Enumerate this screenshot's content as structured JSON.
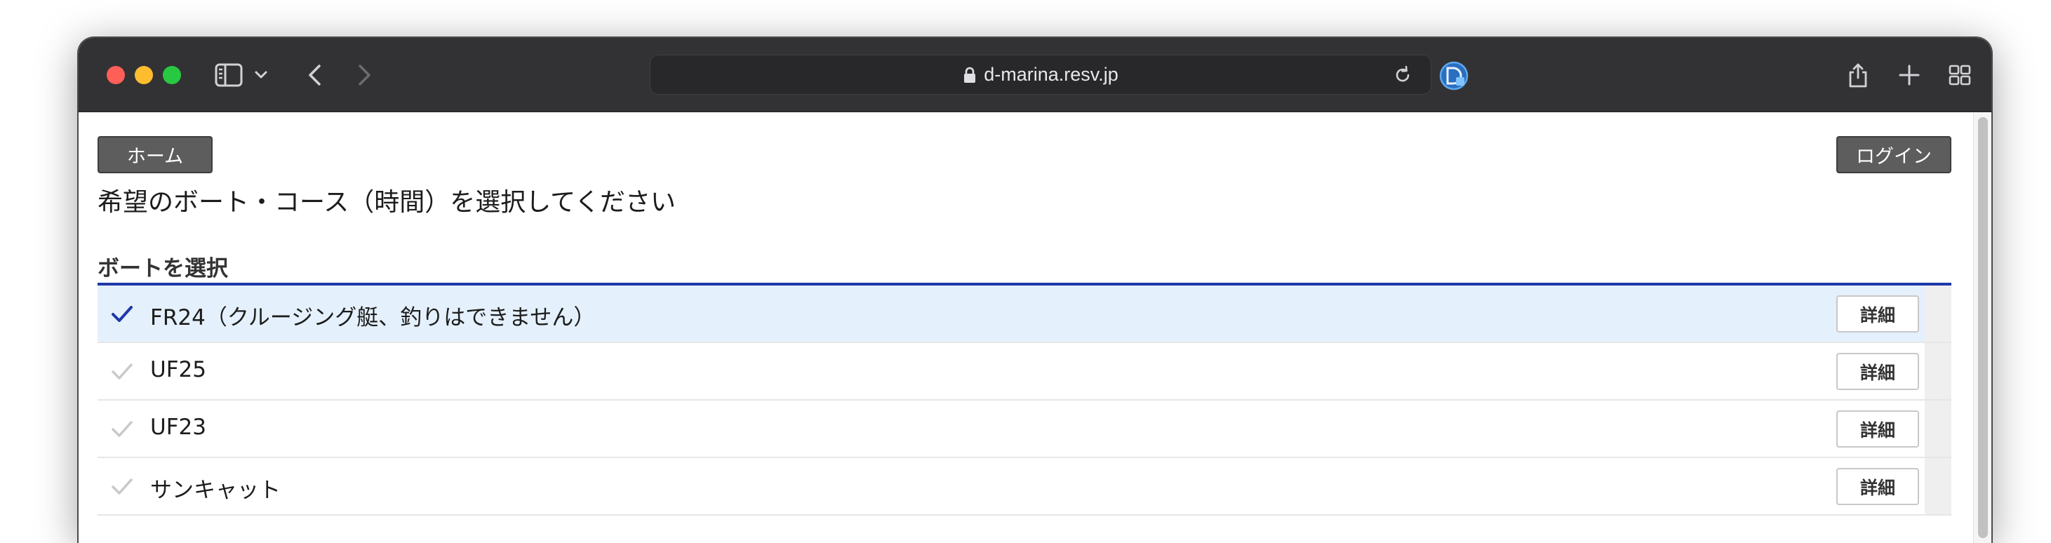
{
  "browser": {
    "url": "d-marina.resv.jp",
    "icons": {
      "sidebar": "sidebar-icon",
      "back": "chevron-left-icon",
      "forward": "chevron-right-icon",
      "lock": "lock-icon",
      "reload": "reload-icon",
      "extension": "extension-d-icon",
      "share": "share-icon",
      "new_tab": "plus-icon",
      "tab_overview": "tab-grid-icon"
    }
  },
  "header": {
    "home_label": "ホーム",
    "login_label": "ログイン"
  },
  "main": {
    "title": "希望のボート・コース（時間）を選択してください",
    "section_title": "ボートを選択",
    "boats": [
      {
        "name": "FR24（クルージング艇、釣りはできません）",
        "selected": true,
        "detail_label": "詳細"
      },
      {
        "name": "UF25",
        "selected": false,
        "detail_label": "詳細"
      },
      {
        "name": "UF23",
        "selected": false,
        "detail_label": "詳細"
      },
      {
        "name": "サンキャット",
        "selected": false,
        "detail_label": "詳細"
      }
    ]
  },
  "colors": {
    "accent": "#1e38a8",
    "selected_row": "#e4f0fb",
    "check_active": "#1e38a8",
    "check_inactive": "#c9c9c9",
    "button_dark": "#5d5d5d",
    "titlebar": "#323235"
  }
}
